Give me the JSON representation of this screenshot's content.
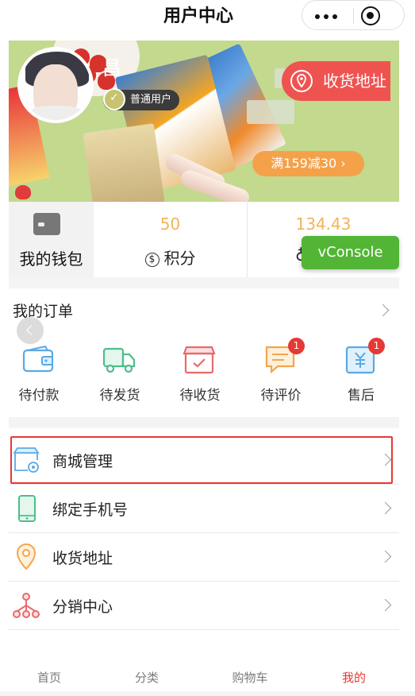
{
  "nav": {
    "title": "用户中心"
  },
  "user": {
    "name": "昌",
    "level": "普通用户"
  },
  "banner": {
    "address_button": "收货地址",
    "promo": "满159减30 ›"
  },
  "stats": {
    "wallet_label": "我的钱包",
    "points_value": "50",
    "points_label": "积分",
    "balance_value": "134.43"
  },
  "vconsole": {
    "label": "vConsole"
  },
  "orders": {
    "title": "我的订单",
    "items": [
      {
        "label": "待付款",
        "icon": "wallet-icon",
        "badge": ""
      },
      {
        "label": "待发货",
        "icon": "truck-icon",
        "badge": ""
      },
      {
        "label": "待收货",
        "icon": "package-icon",
        "badge": ""
      },
      {
        "label": "待评价",
        "icon": "comment-icon",
        "badge": "1"
      },
      {
        "label": "售后",
        "icon": "refund-icon",
        "badge": "1"
      }
    ]
  },
  "menu": {
    "items": [
      {
        "label": "商城管理",
        "icon": "store-settings-icon"
      },
      {
        "label": "绑定手机号",
        "icon": "phone-icon"
      },
      {
        "label": "收货地址",
        "icon": "location-icon"
      },
      {
        "label": "分销中心",
        "icon": "network-icon"
      }
    ]
  },
  "tabbar": {
    "items": [
      {
        "label": "首页"
      },
      {
        "label": "分类"
      },
      {
        "label": "购物车"
      },
      {
        "label": "我的"
      }
    ],
    "active_index": 3
  },
  "colors": {
    "accent_red": "#e53935",
    "points_orange": "#f0b45a",
    "vconsole_green": "#52b535",
    "icon_blue": "#5aa9e6",
    "icon_green": "#4bbf8a",
    "icon_pink": "#e86a6a",
    "icon_orange": "#f3a64b"
  }
}
